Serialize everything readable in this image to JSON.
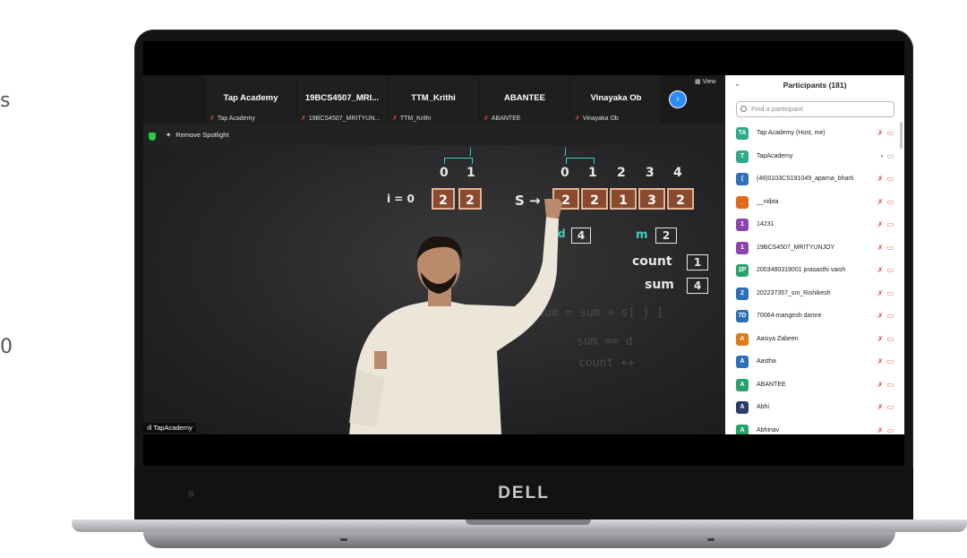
{
  "edge": {
    "top_glyph": "s",
    "bottom_glyph": "0"
  },
  "laptop": {
    "brand": "DELL"
  },
  "zoom": {
    "view_label": "View",
    "thumbnails": [
      {
        "name": "Tap Academy",
        "sub": "Tap Academy"
      },
      {
        "name": "19BCS4507_MRI...",
        "sub": "19BCS4507_MRITYUN..."
      },
      {
        "name": "TTM_Krithi",
        "sub": "TTM_Krithi"
      },
      {
        "name": "ABANTEE",
        "sub": "ABANTEE"
      },
      {
        "name": "Vinayaka Ob",
        "sub": "Vinayaka Ob"
      }
    ],
    "remove_spotlight": "Remove Spotlight",
    "video_name_tag": "TapAcademy",
    "board": {
      "j": "j",
      "small_idx": [
        "0",
        "1"
      ],
      "i_label": "i = 0",
      "small_arr": [
        "2",
        "2"
      ],
      "s_label": "S →",
      "big_idx": [
        "0",
        "1",
        "2",
        "3",
        "4"
      ],
      "big_arr": [
        "2",
        "2",
        "1",
        "3",
        "2"
      ],
      "d_label": "d",
      "d_val": "4",
      "m_label": "m",
      "m_val": "2",
      "count_label": "count",
      "count_val": "1",
      "sum_label": "sum",
      "sum_val": "4",
      "line1": "sum = sum + s[ j ]",
      "line2": "sum == d",
      "line3": "count ++"
    }
  },
  "participants": {
    "title": "Participants (181)",
    "search_placeholder": "Find a participant",
    "list": [
      {
        "initials": "TA",
        "name": "Tap Academy (Host, me)",
        "color": "#2eaa8a",
        "muted": true
      },
      {
        "initials": "T",
        "name": "TapAcademy",
        "color": "#2eaa8a",
        "muted": false
      },
      {
        "initials": "(",
        "name": "(48)0103CS191049_aparna_bharti",
        "color": "#2d6fb8",
        "muted": true
      },
      {
        "initials": "_",
        "name": "__niibta",
        "color": "#e06a1a",
        "muted": true
      },
      {
        "initials": "1",
        "name": "14231",
        "color": "#8e44ad",
        "muted": true
      },
      {
        "initials": "1",
        "name": "19BCS4507_MRITYUNJOY",
        "color": "#8e44ad",
        "muted": true
      },
      {
        "initials": "2P",
        "name": "2003480319001 prasasthi vaish",
        "color": "#27a36b",
        "muted": true
      },
      {
        "initials": "2",
        "name": "202237357_sm_Rishikesh",
        "color": "#2d6fb8",
        "muted": true
      },
      {
        "initials": "7D",
        "name": "70064-mangesh damre",
        "color": "#2d6fb8",
        "muted": true
      },
      {
        "initials": "A",
        "name": "Aasiya Zabeen",
        "color": "#e07a1a",
        "muted": true
      },
      {
        "initials": "A",
        "name": "Aastha",
        "color": "#2d6fb8",
        "muted": true
      },
      {
        "initials": "A",
        "name": "ABANTEE",
        "color": "#27a36b",
        "muted": true
      },
      {
        "initials": "A",
        "name": "Abhi",
        "color": "#2c3e66",
        "muted": true
      },
      {
        "initials": "A",
        "name": "Abhinav",
        "color": "#27a36b",
        "muted": true
      }
    ]
  }
}
